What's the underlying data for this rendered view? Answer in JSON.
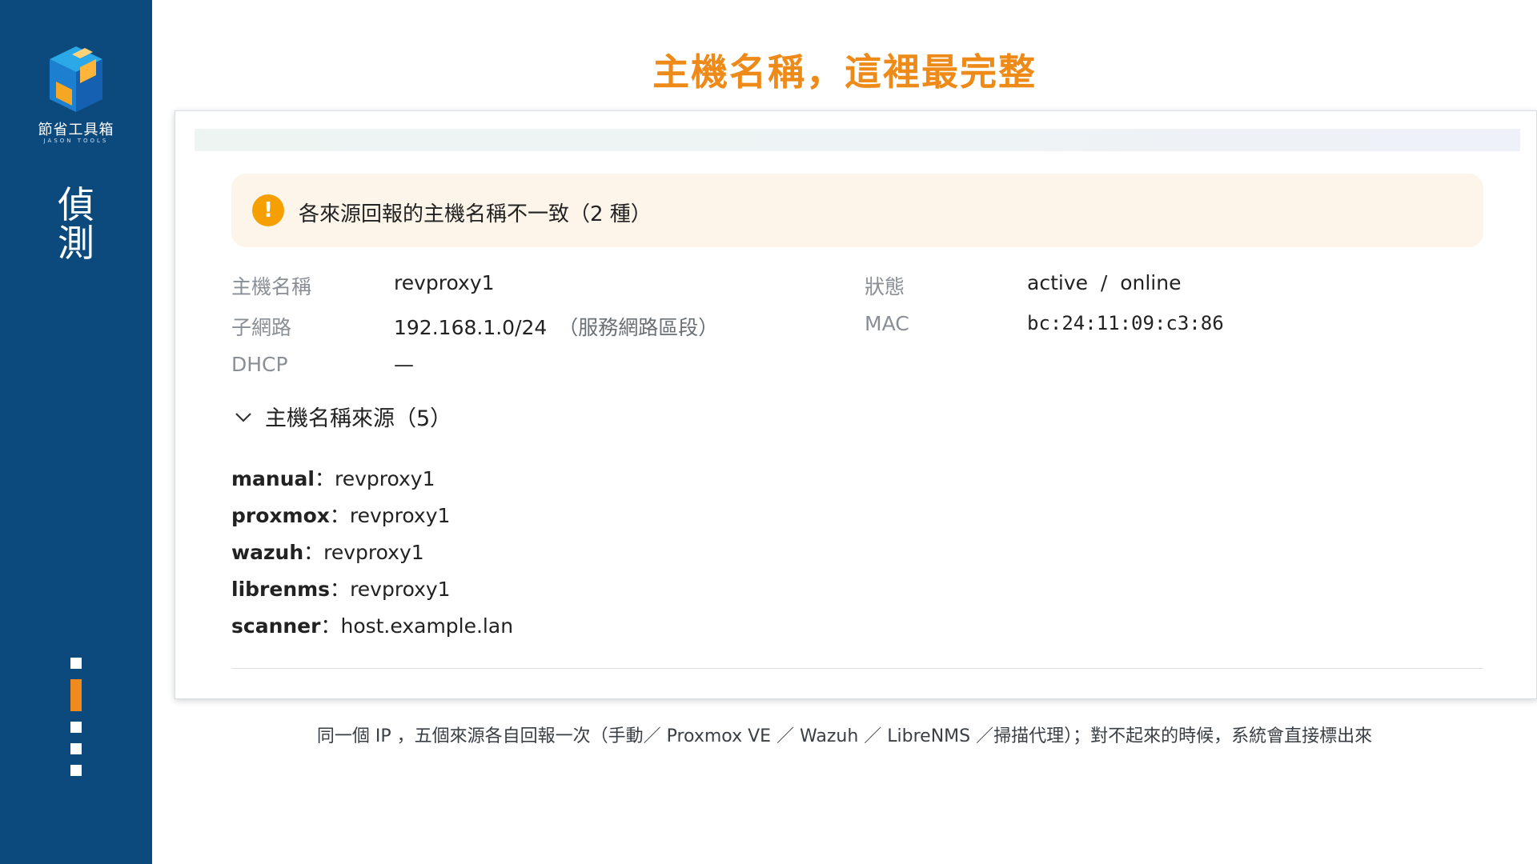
{
  "sidebar": {
    "brand_name": "節省工具箱",
    "brand_sub": "JASON TOOLS",
    "section_char_1": "偵",
    "section_char_2": "測",
    "progress": {
      "total_steps": 5,
      "current_step": 2
    }
  },
  "slide": {
    "title": "主機名稱，這裡最完整",
    "caption": "同一個 IP ，五個來源各自回報一次（手動／ Proxmox VE ／ Wazuh ／ LibreNMS ／掃描代理）；對不起來的時候，系統會直接標出來"
  },
  "alert": {
    "icon": "exclamation-icon",
    "text": "各來源回報的主機名稱不一致（2 種）"
  },
  "details": {
    "hostname_label": "主機名稱",
    "hostname_value": "revproxy1",
    "status_label": "狀態",
    "status_value": "active  /  online",
    "subnet_label": "子網路",
    "subnet_value": "192.168.1.0/24",
    "subnet_note": "（服務網路區段）",
    "mac_label": "MAC",
    "mac_value": "bc:24:11:09:c3:86",
    "dhcp_label": "DHCP",
    "dhcp_value": "—"
  },
  "sources": {
    "header": "主機名稱來源（5）",
    "separator": "：",
    "items": [
      {
        "source": "manual",
        "value": "revproxy1"
      },
      {
        "source": "proxmox",
        "value": "revproxy1"
      },
      {
        "source": "wazuh",
        "value": "revproxy1"
      },
      {
        "source": "librenms",
        "value": "revproxy1"
      },
      {
        "source": "scanner",
        "value": "host.example.lan"
      }
    ]
  },
  "colors": {
    "sidebar_bg": "#0c4a7e",
    "accent_orange": "#ee8a18",
    "alert_bg": "#fdf5e9",
    "alert_icon": "#f5a000"
  }
}
